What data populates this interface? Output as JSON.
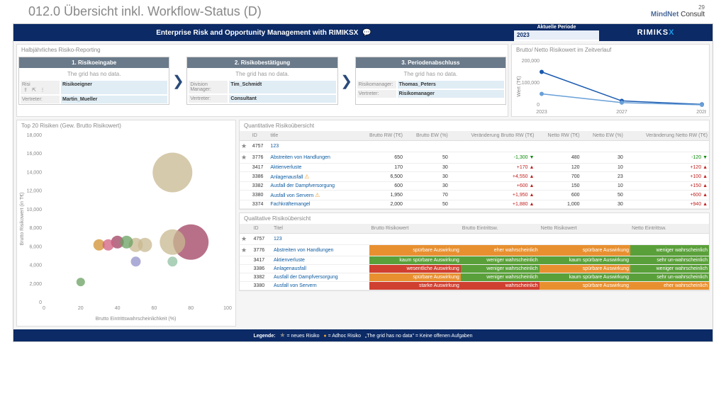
{
  "slide": {
    "title": "012.0 Übersicht inkl. Workflow-Status (D)",
    "page": "29",
    "logo": "MindNet",
    "logo_sub": "Consult"
  },
  "header": {
    "title": "Enterprise Risk and Opportunity Management with RIMIKSX",
    "period_label": "Aktuelle Periode",
    "period_value": "2023",
    "brand": "RIMIKS"
  },
  "workflow": {
    "title": "Halbjährliches Risiko-Reporting",
    "steps": [
      {
        "name": "1. Risikoeingabe",
        "empty": "The grid has no data.",
        "rows": [
          {
            "label": "Risi",
            "value": "Risikoeigner",
            "icons": true
          },
          {
            "label": "Vertreter:",
            "value": "Martin_Mueller"
          }
        ]
      },
      {
        "name": "2. Risikobestätigung",
        "empty": "The grid has no data.",
        "rows": [
          {
            "label": "Division Manager:",
            "value": "Tim_Schmidt"
          },
          {
            "label": "Vertreter:",
            "value": "Consultant"
          }
        ]
      },
      {
        "name": "3. Periodenabschluss",
        "empty": "The grid has no data.",
        "rows": [
          {
            "label": "Risikomanager:",
            "value": "Thomas_Peters"
          },
          {
            "label": "Vertreter:",
            "value": "Risikomanager"
          }
        ]
      }
    ]
  },
  "line_chart": {
    "title": "Brutto/ Netto Risikowert im Zeitverlauf",
    "ylabel": "Wert (T€)"
  },
  "scatter": {
    "title": "Top 20 Risiken (Gew. Brutto Risikowert)",
    "xlabel": "Brutto Eintrittswahrscheinlichkeit (%)",
    "ylabel": "Brutto Risikowert (in T€)"
  },
  "quant": {
    "title": "Quantitative Risikoübersicht",
    "headers": [
      "",
      "ID",
      "title",
      "Brutto RW (T€)",
      "Brutto EW (%)",
      "Veränderung Brutto RW (T€)",
      "Netto RW (T€)",
      "Netto EW (%)",
      "Veränderung Netto RW (T€)"
    ],
    "rows": [
      {
        "star": true,
        "id": "4757",
        "title": "123"
      },
      {
        "star": true,
        "id": "3776",
        "title": "Abstreiten von Handlungen",
        "br": "650",
        "be": "50",
        "vb": "-1,300",
        "vbdir": "dn",
        "nr": "480",
        "ne": "30",
        "vn": "-120",
        "vndir": "dn"
      },
      {
        "id": "3417",
        "title": "Aktienverluste",
        "br": "170",
        "be": "30",
        "vb": "+170",
        "vbdir": "up",
        "nr": "120",
        "ne": "10",
        "vn": "+120",
        "vndir": "up"
      },
      {
        "id": "3386",
        "title": "Anlagenausfall",
        "warn": true,
        "br": "6,500",
        "be": "30",
        "vb": "+4,550",
        "vbdir": "up",
        "nr": "700",
        "ne": "23",
        "vn": "+100",
        "vndir": "up"
      },
      {
        "id": "3382",
        "title": "Ausfall der Dampfversorgung",
        "br": "600",
        "be": "30",
        "vb": "+600",
        "vbdir": "up",
        "nr": "150",
        "ne": "10",
        "vn": "+150",
        "vndir": "up"
      },
      {
        "id": "3380",
        "title": "Ausfall von Servern",
        "warn": true,
        "br": "1,950",
        "be": "70",
        "vb": "+1,950",
        "vbdir": "up",
        "nr": "600",
        "ne": "50",
        "vn": "+600",
        "vndir": "up"
      },
      {
        "id": "3374",
        "title": "Fachkräftemangel",
        "br": "2,000",
        "be": "50",
        "vb": "+1,880",
        "vbdir": "up",
        "nr": "1,000",
        "ne": "30",
        "vn": "+940",
        "vndir": "up"
      }
    ]
  },
  "qual": {
    "title": "Qualitative Risikoübersicht",
    "headers": [
      "",
      "ID",
      "Titel",
      "Brutto Risikowert",
      "Brutto Eintrittsw.",
      "Netto Risikowert",
      "Netto Eintrittsw."
    ],
    "rows": [
      {
        "star": true,
        "id": "4757",
        "title": "123"
      },
      {
        "star": true,
        "id": "3776",
        "title": "Abstreiten von Handlungen",
        "c1": {
          "t": "spürbare Auswirkung",
          "c": "orange"
        },
        "c2": {
          "t": "eher wahrscheinlich",
          "c": "orange"
        },
        "c3": {
          "t": "spürbare Auswirkung",
          "c": "orange"
        },
        "c4": {
          "t": "weniger wahrscheinlich",
          "c": "green"
        }
      },
      {
        "id": "3417",
        "title": "Aktienverluste",
        "c1": {
          "t": "kaum spürbare Auswirkung",
          "c": "green"
        },
        "c2": {
          "t": "weniger wahrscheinlich",
          "c": "green"
        },
        "c3": {
          "t": "kaum spürbare Auswirkung",
          "c": "green"
        },
        "c4": {
          "t": "sehr un-wahrscheinlich",
          "c": "green"
        }
      },
      {
        "id": "3386",
        "title": "Anlagenausfall",
        "c1": {
          "t": "wesentliche Auswirkung",
          "c": "red"
        },
        "c2": {
          "t": "weniger wahrscheinlich",
          "c": "green"
        },
        "c3": {
          "t": "spürbare Auswirkung",
          "c": "orange"
        },
        "c4": {
          "t": "weniger wahrscheinlich",
          "c": "green"
        }
      },
      {
        "id": "3382",
        "title": "Ausfall der Dampfversorgung",
        "c1": {
          "t": "spürbare Auswirkung",
          "c": "orange"
        },
        "c2": {
          "t": "weniger wahrscheinlich",
          "c": "green"
        },
        "c3": {
          "t": "kaum spürbare Auswirkung",
          "c": "green"
        },
        "c4": {
          "t": "sehr un-wahrscheinlich",
          "c": "green"
        }
      },
      {
        "id": "3380",
        "title": "Ausfall von Servern",
        "c1": {
          "t": "starke Auswirkung",
          "c": "red"
        },
        "c2": {
          "t": "wahrscheinlich",
          "c": "red"
        },
        "c3": {
          "t": "spürbare Auswirkung",
          "c": "orange"
        },
        "c4": {
          "t": "eher wahrscheinlich",
          "c": "orange"
        }
      }
    ]
  },
  "footer": {
    "legend": "Legende:",
    "new": "= neues Risiko",
    "adhoc": "= Adhoc Risiko",
    "nodata": "„The grid has no data\" = Keine offenen Aufgaben"
  },
  "chart_data": {
    "line": {
      "type": "line",
      "x": [
        "2023",
        "2027",
        "2028"
      ],
      "series": [
        {
          "name": "Brutto",
          "values": [
            150000,
            18000,
            2000
          ]
        },
        {
          "name": "Netto",
          "values": [
            50000,
            10000,
            0
          ]
        }
      ],
      "ylim": [
        0,
        200000
      ],
      "ylabel": "Wert (T€)"
    },
    "scatter": {
      "type": "scatter",
      "xlabel": "Brutto Eintrittswahrscheinlichkeit (%)",
      "ylabel": "Brutto Risikowert (in T€)",
      "xlim": [
        0,
        100
      ],
      "ylim": [
        0,
        18000
      ],
      "points": [
        {
          "x": 70,
          "y": 14000,
          "r": 28,
          "c": "#c8b890"
        },
        {
          "x": 80,
          "y": 6500,
          "r": 25,
          "c": "#a04060"
        },
        {
          "x": 70,
          "y": 6500,
          "r": 18,
          "c": "#c8b890"
        },
        {
          "x": 50,
          "y": 6200,
          "r": 10,
          "c": "#c8b890"
        },
        {
          "x": 55,
          "y": 6200,
          "r": 10,
          "c": "#c8b890"
        },
        {
          "x": 40,
          "y": 6500,
          "r": 9,
          "c": "#a04060"
        },
        {
          "x": 45,
          "y": 6500,
          "r": 9,
          "c": "#6aa060"
        },
        {
          "x": 30,
          "y": 6200,
          "r": 8,
          "c": "#d09030"
        },
        {
          "x": 35,
          "y": 6200,
          "r": 8,
          "c": "#d06080"
        },
        {
          "x": 50,
          "y": 4400,
          "r": 7,
          "c": "#9090c8"
        },
        {
          "x": 70,
          "y": 4400,
          "r": 7,
          "c": "#90c0a0"
        },
        {
          "x": 20,
          "y": 2200,
          "r": 6,
          "c": "#6aa060"
        }
      ]
    }
  }
}
